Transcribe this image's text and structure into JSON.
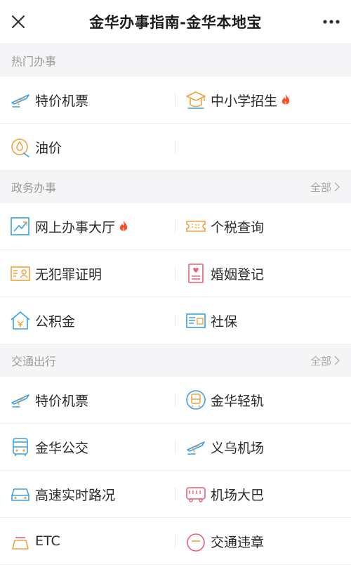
{
  "header": {
    "title": "金华办事指南-金华本地宝"
  },
  "sections": [
    {
      "title": "热门办事",
      "all": ""
    },
    {
      "title": "政务办事",
      "all": "全部"
    },
    {
      "title": "交通出行",
      "all": "全部"
    }
  ],
  "hot": [
    {
      "label": "特价机票",
      "icon": "plane-icon"
    },
    {
      "label": "中小学招生",
      "icon": "graduation-cap-icon",
      "hot": true
    },
    {
      "label": "油价",
      "icon": "oil-drop-icon"
    }
  ],
  "gov": [
    {
      "label": "网上办事大厅",
      "icon": "trend-chart-icon",
      "hot": true
    },
    {
      "label": "个税查询",
      "icon": "ticket-icon"
    },
    {
      "label": "无犯罪证明",
      "icon": "id-card-icon"
    },
    {
      "label": "婚姻登记",
      "icon": "marriage-book-icon"
    },
    {
      "label": "公积金",
      "icon": "house-icon"
    },
    {
      "label": "社保",
      "icon": "card-icon"
    }
  ],
  "traffic": [
    {
      "label": "特价机票",
      "icon": "plane-icon"
    },
    {
      "label": "金华轻轨",
      "icon": "train-icon"
    },
    {
      "label": "金华公交",
      "icon": "bus-icon"
    },
    {
      "label": "义乌机场",
      "icon": "plane-icon"
    },
    {
      "label": "高速实时路况",
      "icon": "car-icon"
    },
    {
      "label": "机场大巴",
      "icon": "coach-icon"
    },
    {
      "label": "ETC",
      "icon": "etc-icon"
    },
    {
      "label": "交通违章",
      "icon": "violation-icon"
    }
  ],
  "colors": {
    "accent": "#3aa0e6",
    "orange": "#f2a23c",
    "pink": "#e9607a",
    "hot": "#ff4b2b"
  }
}
